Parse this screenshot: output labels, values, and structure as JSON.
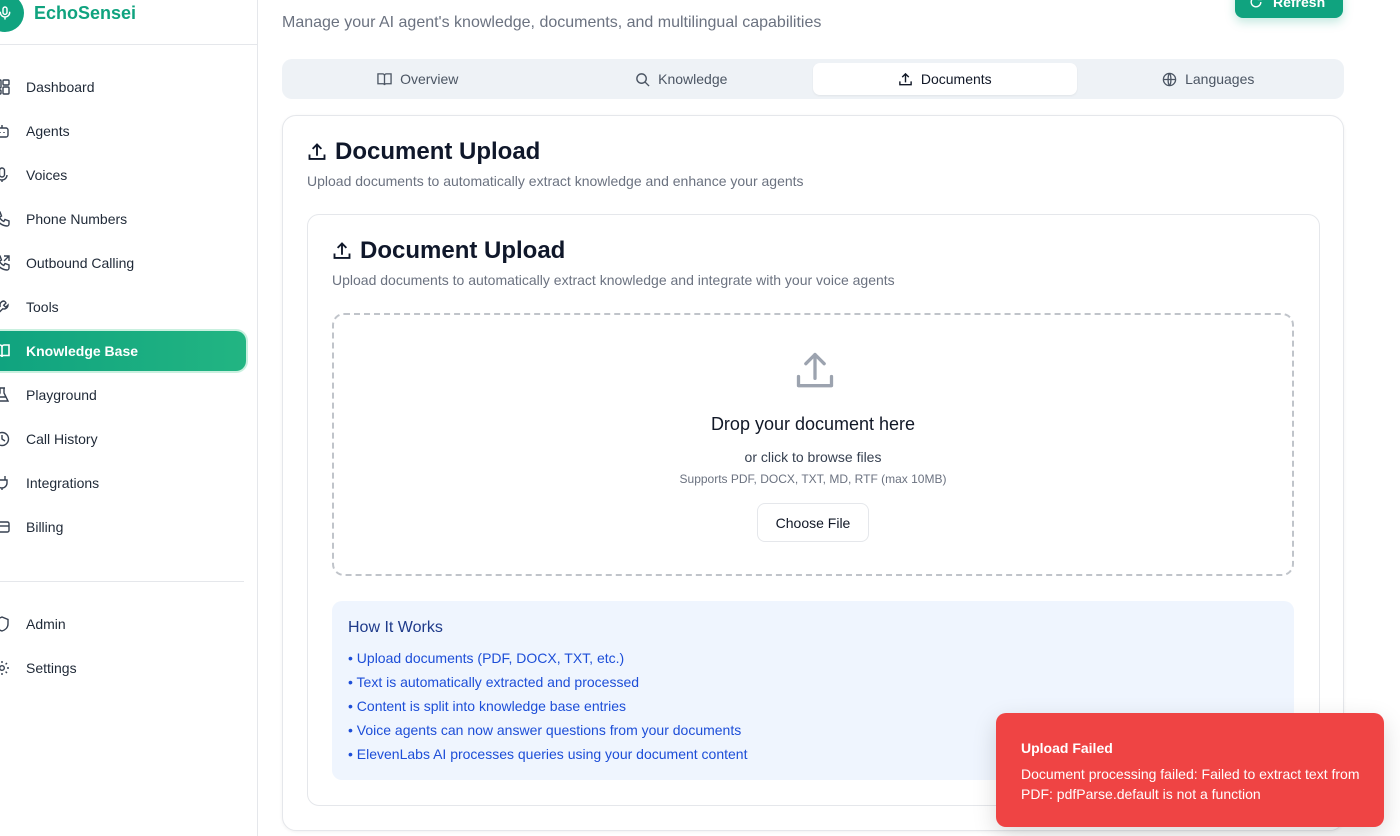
{
  "brand": {
    "name": "EchoSensei"
  },
  "sidebar": {
    "items": [
      {
        "label": "Dashboard",
        "icon": "dashboard-icon"
      },
      {
        "label": "Agents",
        "icon": "bot-icon"
      },
      {
        "label": "Voices",
        "icon": "mic-icon"
      },
      {
        "label": "Phone Numbers",
        "icon": "phone-icon"
      },
      {
        "label": "Outbound Calling",
        "icon": "phone-outgoing-icon"
      },
      {
        "label": "Tools",
        "icon": "wrench-icon"
      },
      {
        "label": "Knowledge Base",
        "icon": "book-icon",
        "active": true
      },
      {
        "label": "Playground",
        "icon": "flask-icon"
      },
      {
        "label": "Call History",
        "icon": "history-icon"
      },
      {
        "label": "Integrations",
        "icon": "plug-icon"
      },
      {
        "label": "Billing",
        "icon": "credit-card-icon"
      }
    ],
    "bottom_items": [
      {
        "label": "Admin",
        "icon": "shield-icon"
      },
      {
        "label": "Settings",
        "icon": "gear-icon"
      }
    ]
  },
  "header": {
    "subtitle": "Manage your AI agent's knowledge, documents, and multilingual capabilities",
    "refresh_label": "Refresh"
  },
  "tabs": [
    {
      "label": "Overview",
      "icon": "book-open-icon"
    },
    {
      "label": "Knowledge",
      "icon": "search-icon"
    },
    {
      "label": "Documents",
      "icon": "upload-icon",
      "active": true
    },
    {
      "label": "Languages",
      "icon": "globe-icon"
    }
  ],
  "outer_card": {
    "title": "Document Upload",
    "description": "Upload documents to automatically extract knowledge and enhance your agents"
  },
  "inner_card": {
    "title": "Document Upload",
    "description": "Upload documents to automatically extract knowledge and integrate with your voice agents"
  },
  "dropzone": {
    "title": "Drop your document here",
    "subtitle": "or click to browse files",
    "hint": "Supports PDF, DOCX, TXT, MD, RTF (max 10MB)",
    "button_label": "Choose File"
  },
  "how_it_works": {
    "title": "How It Works",
    "items": [
      "• Upload documents (PDF, DOCX, TXT, etc.)",
      "• Text is automatically extracted and processed",
      "• Content is split into knowledge base entries",
      "• Voice agents can now answer questions from your documents",
      "• ElevenLabs AI processes queries using your document content"
    ]
  },
  "toast": {
    "title": "Upload Failed",
    "message": "Document processing failed: Failed to extract text from PDF: pdfParse.default is not a function"
  },
  "colors": {
    "brand": "#10a37f",
    "error": "#ef4444",
    "info_bg": "#eff5fe",
    "info_text": "#1d4ed8"
  }
}
